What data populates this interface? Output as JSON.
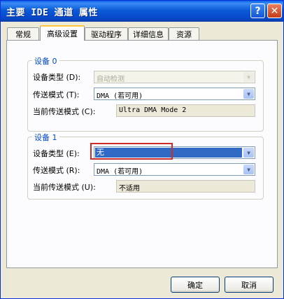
{
  "window": {
    "title": "主要 IDE 通道 属性",
    "help_label": "?",
    "close_label": "✕"
  },
  "tabs": [
    {
      "label": "常规"
    },
    {
      "label": "高级设置",
      "active": true
    },
    {
      "label": "驱动程序"
    },
    {
      "label": "详细信息"
    },
    {
      "label": "资源"
    }
  ],
  "device0": {
    "title": "设备 0",
    "type_label": "设备类型 (D):",
    "type_value": "自动检测",
    "mode_label": "传送模式 (T):",
    "mode_value": "DMA (若可用)",
    "current_label": "当前传送模式 (C):",
    "current_value": "Ultra DMA Mode 2"
  },
  "device1": {
    "title": "设备 1",
    "type_label": "设备类型 (E):",
    "type_value": "无",
    "mode_label": "传送模式 (R):",
    "mode_value": "DMA (若可用)",
    "current_label": "当前传送模式 (U):",
    "current_value": "不适用"
  },
  "buttons": {
    "ok": "确定",
    "cancel": "取消"
  },
  "icons": {
    "dropdown": "chevron-down-icon"
  },
  "colors": {
    "title_bar": "#0a5fe8",
    "group_title": "#0046d5",
    "selection": "#316ac5",
    "highlight_box": "#d02a2a"
  }
}
